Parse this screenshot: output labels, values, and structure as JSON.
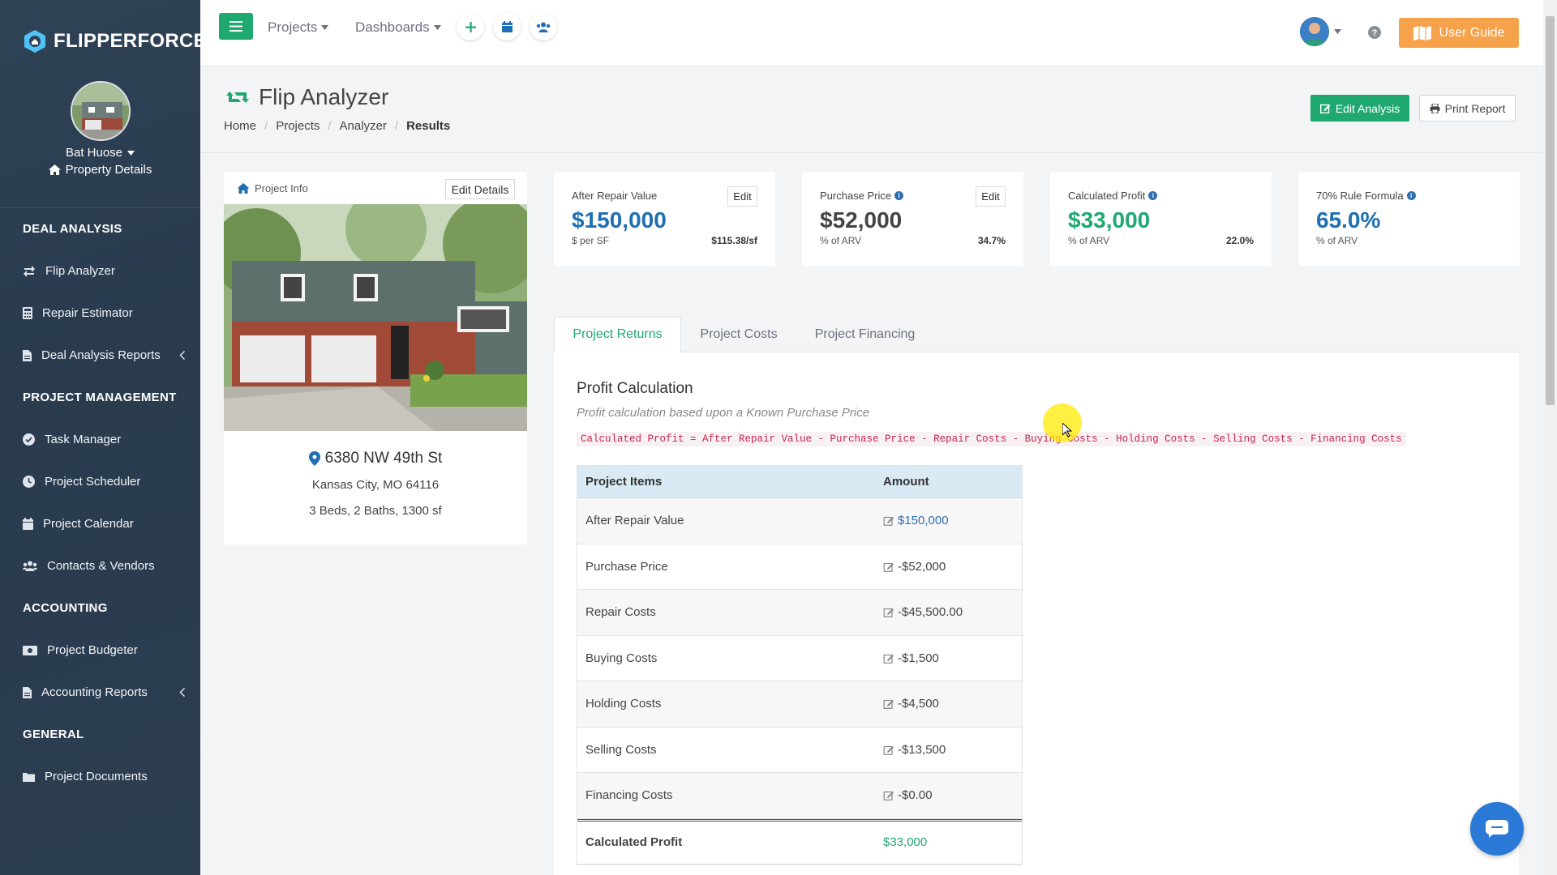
{
  "app": {
    "brand": "FLIPPERFORCE",
    "accent": "#1fa971"
  },
  "profile": {
    "name": "Bat Huose",
    "details_link": "Property Details"
  },
  "sidebar": {
    "sections": [
      {
        "title": "DEAL ANALYSIS",
        "items": [
          {
            "label": "Flip Analyzer",
            "icon": "swap-icon"
          },
          {
            "label": "Repair Estimator",
            "icon": "calculator-icon"
          },
          {
            "label": "Deal Analysis Reports",
            "icon": "file-icon",
            "expandable": true
          }
        ]
      },
      {
        "title": "PROJECT MANAGEMENT",
        "items": [
          {
            "label": "Task Manager",
            "icon": "check-circle-icon"
          },
          {
            "label": "Project Scheduler",
            "icon": "clock-icon"
          },
          {
            "label": "Project Calendar",
            "icon": "calendar-icon"
          },
          {
            "label": "Contacts & Vendors",
            "icon": "users-icon"
          }
        ]
      },
      {
        "title": "ACCOUNTING",
        "items": [
          {
            "label": "Project Budgeter",
            "icon": "money-icon"
          },
          {
            "label": "Accounting Reports",
            "icon": "file-icon",
            "expandable": true
          }
        ]
      },
      {
        "title": "GENERAL",
        "items": [
          {
            "label": "Project Documents",
            "icon": "folder-icon"
          }
        ]
      }
    ]
  },
  "topbar": {
    "projects": "Projects",
    "dashboards": "Dashboards",
    "user_guide": "User Guide"
  },
  "page": {
    "title": "Flip Analyzer",
    "breadcrumb": [
      "Home",
      "Projects",
      "Analyzer",
      "Results"
    ],
    "edit_analysis": "Edit Analysis",
    "print_report": "Print Report"
  },
  "project_info": {
    "header": "Project Info",
    "edit_details": "Edit Details",
    "address": "6380 NW 49th St",
    "city": "Kansas City, MO 64116",
    "specs": "3 Beds, 2 Baths, 1300 sf"
  },
  "metrics": [
    {
      "label": "After Repair Value",
      "value": "$150,000",
      "sub": "$ per SF",
      "right": "$115.38/sf",
      "edit": "Edit",
      "color": "#1f6fb2"
    },
    {
      "label": "Purchase Price",
      "value": "$52,000",
      "sub": "% of ARV",
      "right": "34.7%",
      "edit": "Edit",
      "color": "#444444"
    },
    {
      "label": "Calculated Profit",
      "value": "$33,000",
      "sub": "% of ARV",
      "right": "22.0%",
      "color": "#1fa971"
    },
    {
      "label": "70% Rule Formula",
      "value": "65.0%",
      "sub": "% of ARV",
      "color": "#1f6fb2"
    }
  ],
  "tabs": [
    "Project Returns",
    "Project Costs",
    "Project Financing"
  ],
  "profit": {
    "title": "Profit Calculation",
    "subtitle": "Profit calculation based upon a Known Purchase Price",
    "formula": "Calculated Profit = After Repair Value - Purchase Price - Repair Costs - Buying Costs - Holding Costs - Selling Costs - Financing Costs",
    "col_items": "Project Items",
    "col_amount": "Amount",
    "rows": [
      {
        "item": "After Repair Value",
        "amount": "$150,000"
      },
      {
        "item": "Purchase Price",
        "amount": "-$52,000"
      },
      {
        "item": "Repair Costs",
        "amount": "-$45,500.00"
      },
      {
        "item": "Buying Costs",
        "amount": "-$1,500"
      },
      {
        "item": "Holding Costs",
        "amount": "-$4,500"
      },
      {
        "item": "Selling Costs",
        "amount": "-$13,500"
      },
      {
        "item": "Financing Costs",
        "amount": "-$0.00"
      }
    ],
    "total_label": "Calculated Profit",
    "total_amount": "$33,000"
  }
}
